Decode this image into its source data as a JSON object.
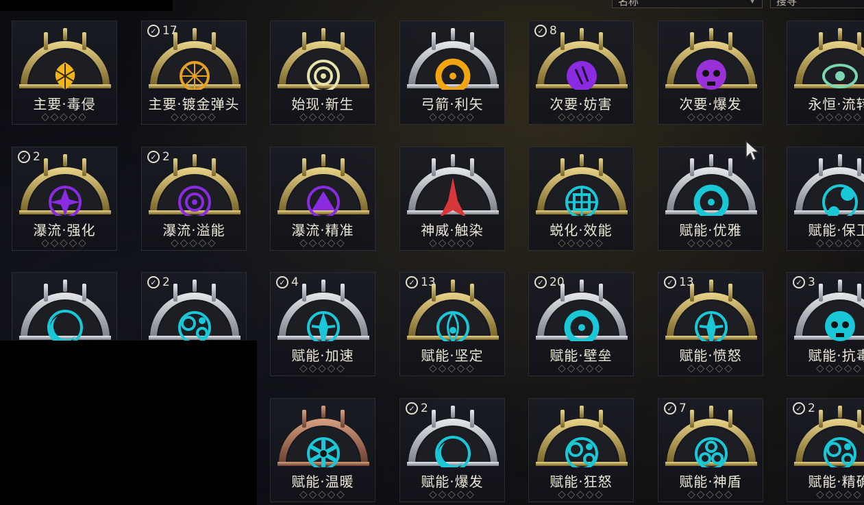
{
  "header": {
    "sort_dropdown": "名称",
    "search_dropdown": "搜寻"
  },
  "rank_symbol": "◇◇◇◇◇",
  "mods": [
    {
      "name": "主要·毒侵",
      "count": null,
      "frame": "gold",
      "color": "#f2b51c",
      "glyph": "leaf"
    },
    {
      "name": "主要·镀金弹头",
      "count": "17",
      "frame": "gold",
      "color": "#e8a020",
      "glyph": "web"
    },
    {
      "name": "始现·新生",
      "count": null,
      "frame": "gold",
      "color": "#e6e2a8",
      "glyph": "spiral"
    },
    {
      "name": "弓箭·利矢",
      "count": null,
      "frame": "silver",
      "color": "#f2a50c",
      "glyph": "ring"
    },
    {
      "name": "次要·妨害",
      "count": "8",
      "frame": "gold",
      "color": "#8a2be2",
      "glyph": "claw"
    },
    {
      "name": "次要·爆发",
      "count": null,
      "frame": "gold",
      "color": "#9a30d8",
      "glyph": "skull"
    },
    {
      "name": "永恒·流转",
      "count": null,
      "frame": "gold",
      "color": "#7ad6b0",
      "glyph": "eye"
    },
    {
      "name": "瀑流·强化",
      "count": "2",
      "frame": "gold",
      "color": "#8a2be2",
      "glyph": "star"
    },
    {
      "name": "瀑流·溢能",
      "count": "2",
      "frame": "gold",
      "color": "#8a2be2",
      "glyph": "spiral"
    },
    {
      "name": "瀑流·精准",
      "count": null,
      "frame": "gold",
      "color": "#8a2be2",
      "glyph": "triangle"
    },
    {
      "name": "神威·触染",
      "count": null,
      "frame": "silver",
      "color": "#d8373a",
      "glyph": "spike"
    },
    {
      "name": "蜕化·效能",
      "count": null,
      "frame": "gold",
      "color": "#19c7d6",
      "glyph": "cross"
    },
    {
      "name": "赋能·优雅",
      "count": null,
      "frame": "silver",
      "color": "#19c7d6",
      "glyph": "ring"
    },
    {
      "name": "赋能·保卫",
      "count": null,
      "frame": "silver",
      "color": "#19c7d6",
      "glyph": "shield"
    },
    {
      "name": "",
      "count": null,
      "frame": "silver",
      "color": "#19c7d6",
      "glyph": "moon"
    },
    {
      "name": "",
      "count": "2",
      "frame": "silver",
      "color": "#19c7d6",
      "glyph": "bubbles"
    },
    {
      "name": "赋能·加速",
      "count": "4",
      "frame": "silver",
      "color": "#19c7d6",
      "glyph": "blade"
    },
    {
      "name": "赋能·坚定",
      "count": "13",
      "frame": "gold",
      "color": "#19c7d6",
      "glyph": "flame"
    },
    {
      "name": "赋能·壁垒",
      "count": "20",
      "frame": "silver",
      "color": "#19c7d6",
      "glyph": "ring"
    },
    {
      "name": "赋能·愤怒",
      "count": "13",
      "frame": "gold",
      "color": "#19c7d6",
      "glyph": "blade"
    },
    {
      "name": "赋能·抗毒",
      "count": "3",
      "frame": "silver",
      "color": "#19c7d6",
      "glyph": "skull"
    },
    {
      "name": "",
      "count": null,
      "frame": "copper",
      "color": "#19c7d6",
      "glyph": "flower"
    },
    {
      "name": "",
      "count": null,
      "frame": "copper",
      "color": "#19c7d6",
      "glyph": "flower"
    },
    {
      "name": "赋能·温暖",
      "count": null,
      "frame": "copper",
      "color": "#19c7d6",
      "glyph": "flower"
    },
    {
      "name": "赋能·爆发",
      "count": "2",
      "frame": "silver",
      "color": "#19c7d6",
      "glyph": "moon"
    },
    {
      "name": "赋能·狂怒",
      "count": null,
      "frame": "gold",
      "color": "#19c7d6",
      "glyph": "bubbles"
    },
    {
      "name": "赋能·神盾",
      "count": "7",
      "frame": "gold",
      "color": "#19c7d6",
      "glyph": "triskel"
    },
    {
      "name": "赋能·精确",
      "count": "2",
      "frame": "gold",
      "color": "#19c7d6",
      "glyph": "bubbles"
    }
  ],
  "frame_colors": {
    "gold": {
      "light": "#e9d48a",
      "dark": "#7a6428"
    },
    "silver": {
      "light": "#e6e8ec",
      "dark": "#7c8088"
    },
    "copper": {
      "light": "#d8a080",
      "dark": "#6a4030"
    }
  }
}
